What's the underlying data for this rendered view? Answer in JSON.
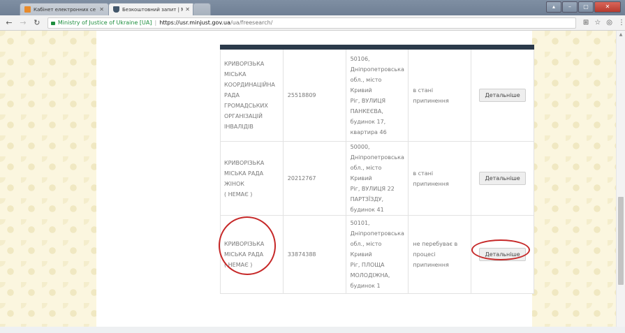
{
  "browser": {
    "tabs": [
      {
        "title": "Кабінет електронних се",
        "active": false
      },
      {
        "title": "Безкоштовний запит | М",
        "active": true
      }
    ],
    "address": {
      "site_name": "Ministry of Justice of Ukraine [UA]",
      "url_host": "https://usr.minjust.gov.ua",
      "url_path": "/ua/freesearch/"
    },
    "icons": [
      "back-icon",
      "forward-icon",
      "reload-icon",
      "lock-icon",
      "translate-icon",
      "star-icon",
      "extension-icon",
      "menu-icon"
    ]
  },
  "table": {
    "rows": [
      {
        "name_lines": [
          "КРИВОРІЗЬКА",
          "МІСЬКА",
          "КООРДИНАЦІЙНА",
          "РАДА",
          "ГРОМАДСЬКИХ",
          "ОРГАНІЗАЦІЙ",
          "ІНВАЛІДІВ"
        ],
        "code": "25518809",
        "address_lines": [
          "50106,",
          "Дніпропетровська",
          "обл., місто Кривий",
          "Ріг, ВУЛИЦЯ",
          "ПАНКЕЄВА,",
          "будинок 17,",
          "квартира 46"
        ],
        "state_lines": [
          "в стані припинення"
        ],
        "button": "Детальніше"
      },
      {
        "name_lines": [
          "КРИВОРІЗЬКА",
          "МІСЬКА РАДА",
          "ЖІНОК",
          "( НЕМАЄ )"
        ],
        "code": "20212767",
        "address_lines": [
          "50000,",
          "Дніпропетровська",
          "обл., місто Кривий",
          "Ріг, ВУЛИЦЯ 22",
          "ПАРТЗЇЗДУ,",
          "будинок 41"
        ],
        "state_lines": [
          "в стані припинення"
        ],
        "button": "Детальніше"
      },
      {
        "name_lines": [
          "КРИВОРІЗЬКА",
          "МІСЬКА РАДА",
          "( НЕМАЄ )"
        ],
        "code": "33874388",
        "address_lines": [
          "50101,",
          "Дніпропетровська",
          "обл., місто Кривий",
          "Ріг, ПЛОЩА",
          "МОЛОДІЖНА,",
          "будинок 1"
        ],
        "state_lines": [
          "не перебуває в",
          "процесі",
          "припинення"
        ],
        "button": "Детальніше"
      }
    ]
  },
  "colors": {
    "highlight_ring": "#c62828",
    "table_header": "#2b3a4a",
    "page_pattern": "#fbf6df"
  }
}
